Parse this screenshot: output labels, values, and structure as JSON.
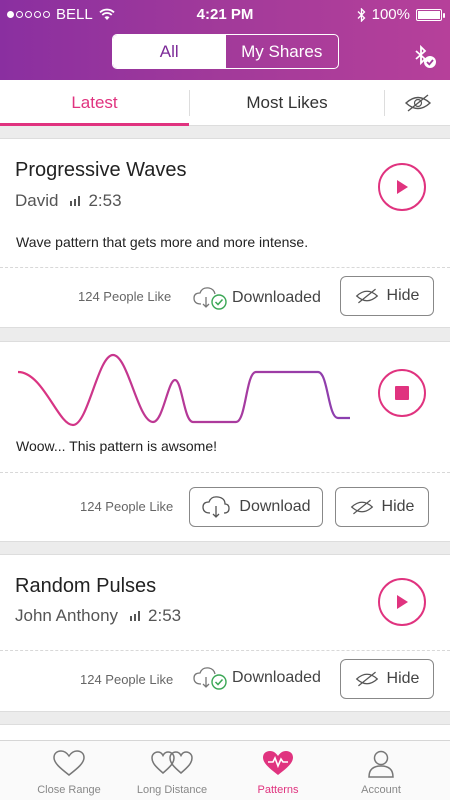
{
  "status_bar": {
    "carrier": "BELL",
    "time": "4:21 PM",
    "battery": "100%"
  },
  "header": {
    "segments": [
      "All",
      "My Shares"
    ],
    "selected": "All"
  },
  "tabs": [
    "Latest",
    "Most Likes"
  ],
  "active_tab": "Latest",
  "patterns": [
    {
      "title": "Progressive Waves",
      "author": "David",
      "duration": "2:53",
      "description": "Wave pattern that gets more and more intense.",
      "likes": "124 People Like",
      "status": "Downloaded",
      "hide_label": "Hide"
    },
    {
      "description": "Woow... This pattern is awsome!",
      "likes": "124 People Like",
      "download_label": "Download",
      "hide_label": "Hide"
    },
    {
      "title": "Random Pulses",
      "author": "John Anthony",
      "duration": "2:53",
      "likes": "124 People Like",
      "status": "Downloaded",
      "hide_label": "Hide"
    }
  ],
  "tab_bar": [
    "Close Range",
    "Long Distance",
    "Patterns",
    "Account"
  ],
  "active_nav": "Patterns",
  "colors": {
    "accent": "#e0337f",
    "header_start": "#8a2fa0",
    "header_end": "#b6409a"
  }
}
